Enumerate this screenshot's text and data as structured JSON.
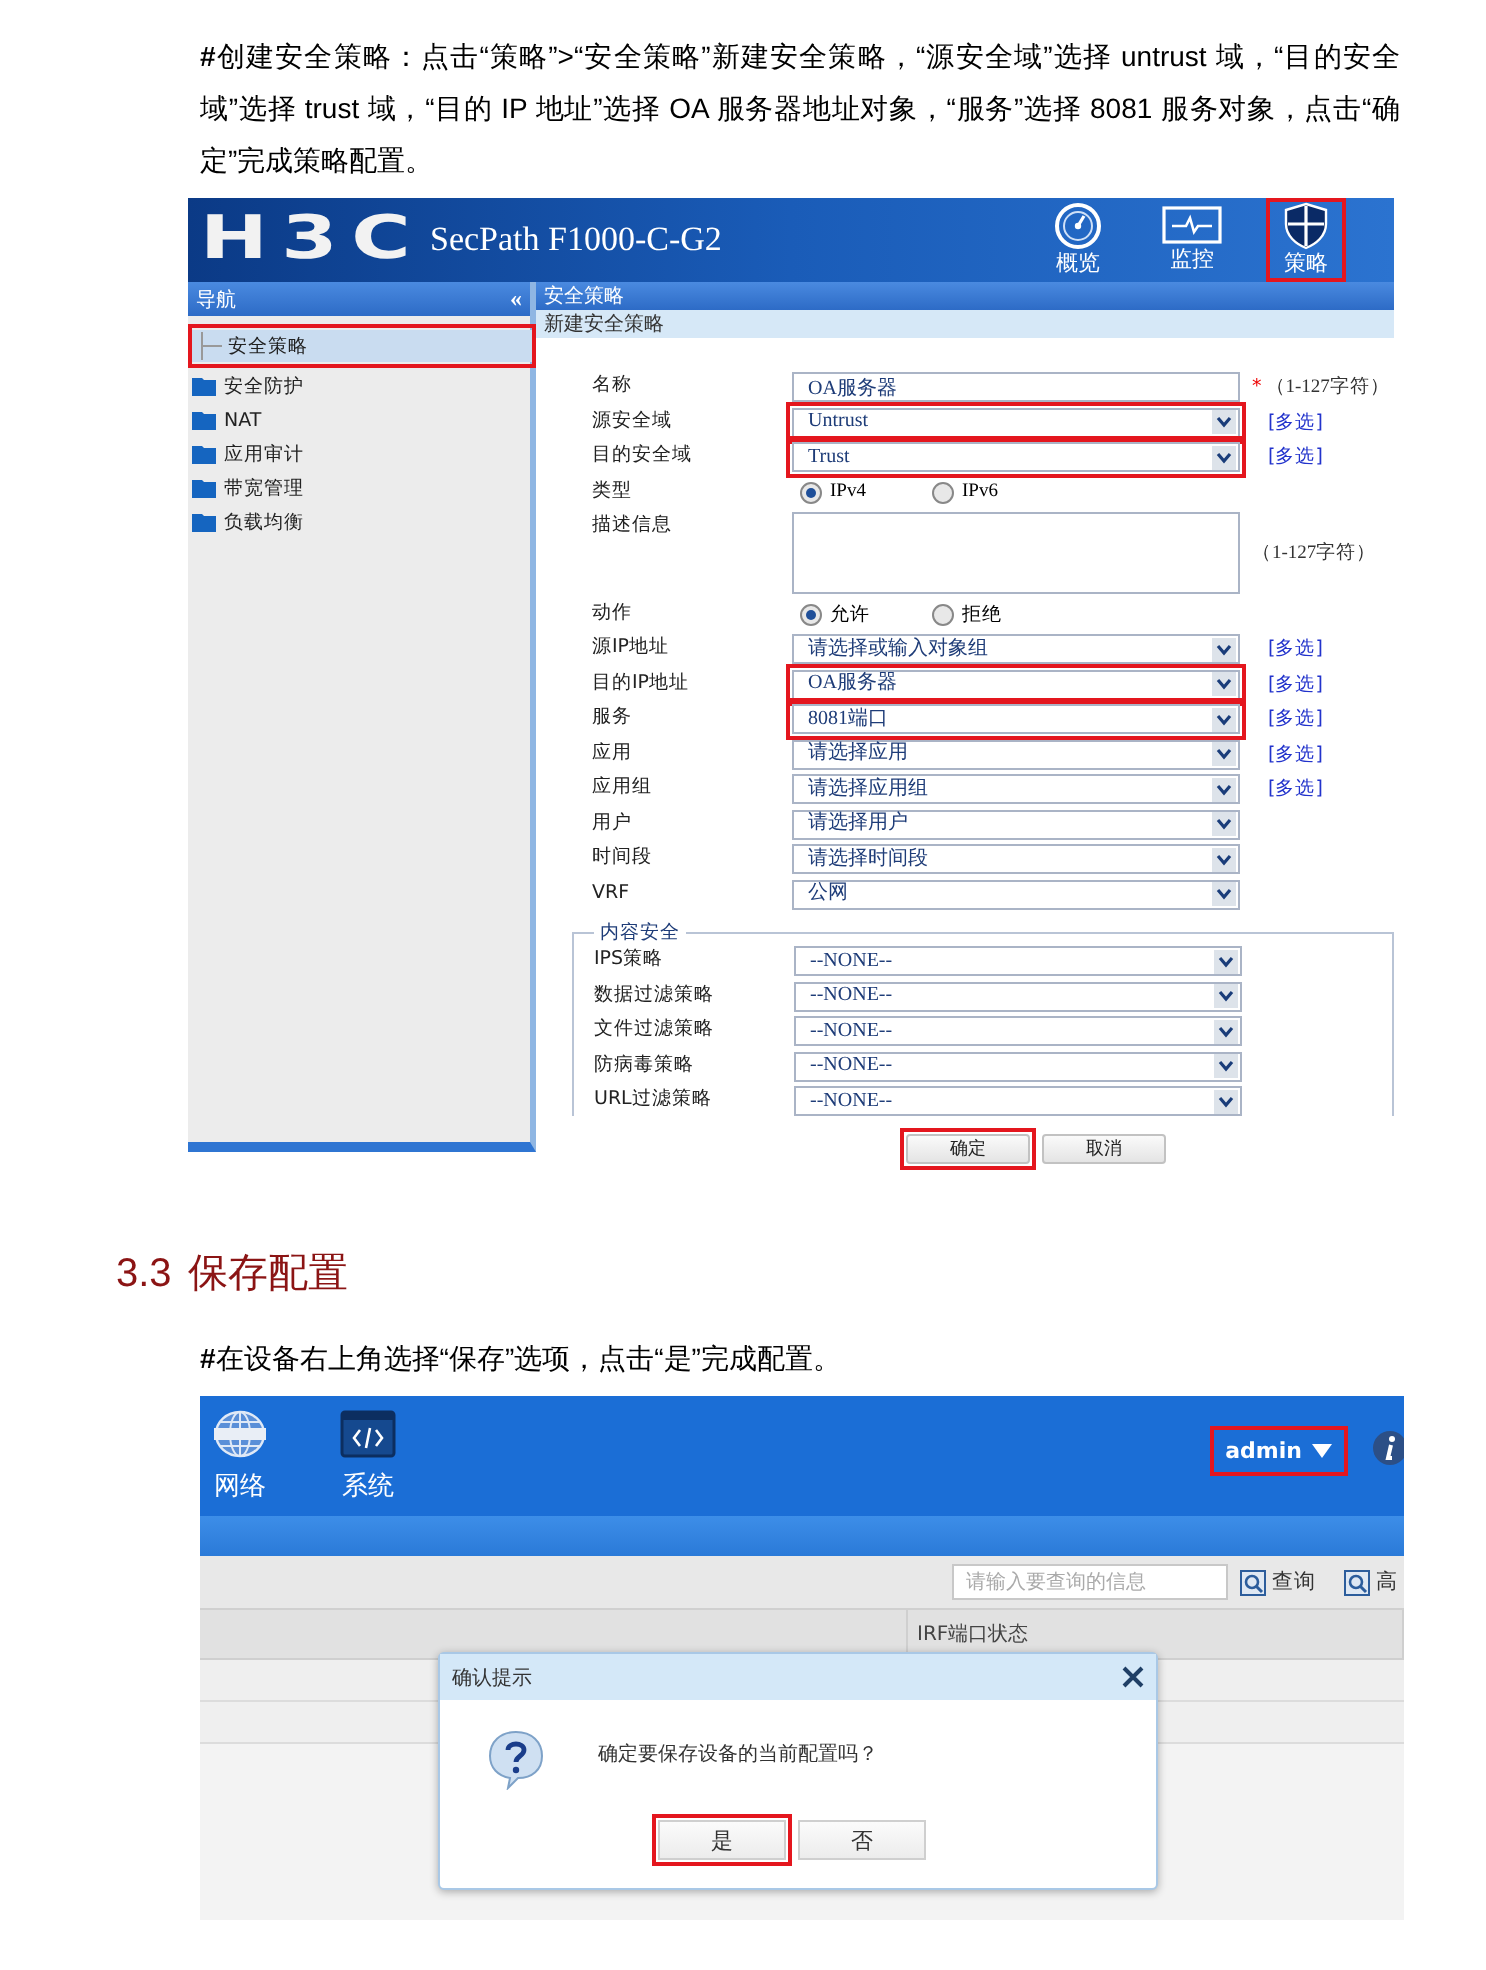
{
  "intro_paragraph": "**#**创建安全策略：点击“策略”>“安全策略”新建安全策略，“源安全域”选择 untrust 域，“目的安全域”选择 trust 域，“目的 IP 地址”选择 OA 服务器地址对象，“服务”选择 8081 服务对象，点击“确定”完成策略配置。",
  "screenshot_1": {
    "brand": "H3C",
    "product": "SecPath F1000-C-G2",
    "top_tabs": [
      {
        "label": "概览",
        "highlighted": false
      },
      {
        "label": "监控",
        "highlighted": false
      },
      {
        "label": "策略",
        "highlighted": true
      }
    ],
    "nav": {
      "title": "导航",
      "collapse": "«",
      "items": [
        {
          "label": "安全策略",
          "kind": "leaf",
          "selected": true,
          "highlighted": true
        },
        {
          "label": "安全防护",
          "kind": "folder",
          "selected": false,
          "highlighted": false
        },
        {
          "label": "NAT",
          "kind": "folder",
          "selected": false,
          "highlighted": false
        },
        {
          "label": "应用审计",
          "kind": "folder",
          "selected": false,
          "highlighted": false
        },
        {
          "label": "带宽管理",
          "kind": "folder",
          "selected": false,
          "highlighted": false
        },
        {
          "label": "负载均衡",
          "kind": "folder",
          "selected": false,
          "highlighted": false
        }
      ]
    },
    "page_title": "安全策略",
    "form_title": "新建安全策略",
    "fields": [
      {
        "label": "名称",
        "kind": "text",
        "value": "OA服务器",
        "mark": "*",
        "hint": "（1-127字符）",
        "highlighted": false
      },
      {
        "label": "源安全域",
        "kind": "select",
        "value": "Untrust",
        "link": "[多选]",
        "highlighted": true
      },
      {
        "label": "目的安全域",
        "kind": "select",
        "value": "Trust",
        "link": "[多选]",
        "highlighted": true
      },
      {
        "label": "类型",
        "kind": "radio",
        "options": [
          {
            "label": "IPv4",
            "selected": true
          },
          {
            "label": "IPv6",
            "selected": false
          }
        ]
      },
      {
        "label": "描述信息",
        "kind": "textarea",
        "hint": "（1-127字符）",
        "highlighted": false
      },
      {
        "label": "动作",
        "kind": "radio",
        "options": [
          {
            "label": "允许",
            "selected": true
          },
          {
            "label": "拒绝",
            "selected": false
          }
        ]
      },
      {
        "label": "源IP地址",
        "kind": "select",
        "value": "请选择或输入对象组",
        "link": "[多选]",
        "highlighted": false
      },
      {
        "label": "目的IP地址",
        "kind": "select",
        "value": "OA服务器",
        "link": "[多选]",
        "highlighted": true
      },
      {
        "label": "服务",
        "kind": "select",
        "value": "8081端口",
        "link": "[多选]",
        "highlighted": true
      },
      {
        "label": "应用",
        "kind": "select",
        "value": "请选择应用",
        "link": "[多选]",
        "highlighted": false
      },
      {
        "label": "应用组",
        "kind": "select",
        "value": "请选择应用组",
        "link": "[多选]",
        "highlighted": false
      },
      {
        "label": "用户",
        "kind": "select",
        "value": "请选择用户",
        "highlighted": false
      },
      {
        "label": "时间段",
        "kind": "select",
        "value": "请选择时间段",
        "highlighted": false
      },
      {
        "label": "VRF",
        "kind": "select",
        "value": "公网",
        "highlighted": false
      }
    ],
    "content_security": {
      "legend": "内容安全",
      "fields": [
        {
          "label": "IPS策略",
          "value": "--NONE--"
        },
        {
          "label": "数据过滤策略",
          "value": "--NONE--"
        },
        {
          "label": "文件过滤策略",
          "value": "--NONE--"
        },
        {
          "label": "防病毒策略",
          "value": "--NONE--"
        },
        {
          "label": "URL过滤策略",
          "value": "--NONE--"
        }
      ]
    },
    "buttons": [
      {
        "label": "确定",
        "highlighted": true
      },
      {
        "label": "取消",
        "highlighted": false
      }
    ]
  },
  "section_heading": {
    "number": "3.3",
    "title": "保存配置"
  },
  "save_paragraph": "**#**在设备右上角选择“保存”选项，点击“是”完成配置。",
  "screenshot_2": {
    "top_tabs": [
      {
        "label": "网络"
      },
      {
        "label": "系统"
      }
    ],
    "user_menu": {
      "label": "admin",
      "highlighted": true
    },
    "search": {
      "placeholder": "请输入要查询的信息"
    },
    "toolbar_buttons": [
      "查询",
      "高"
    ],
    "table": {
      "columns": [
        "",
        "IRF端口状态"
      ]
    },
    "dialog": {
      "title": "确认提示",
      "message": "确定要保存设备的当前配置吗？",
      "buttons": [
        {
          "label": "是",
          "highlighted": true
        },
        {
          "label": "否",
          "highlighted": false
        }
      ]
    }
  }
}
